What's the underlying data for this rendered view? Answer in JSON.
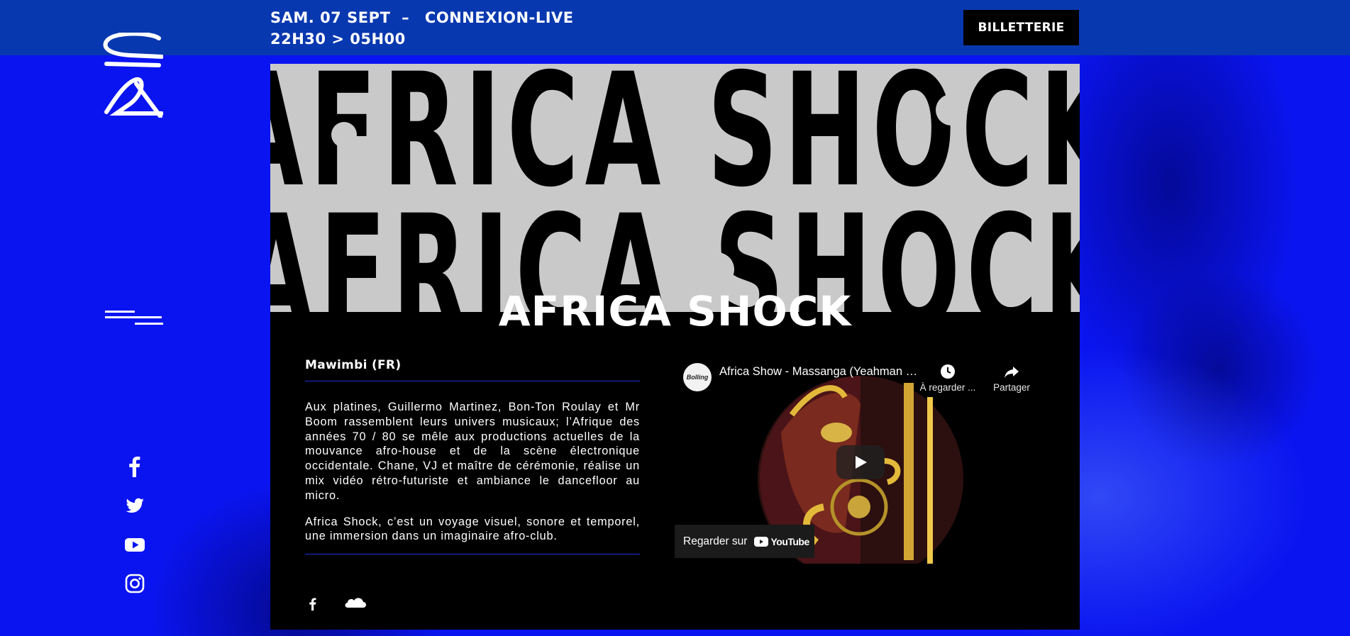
{
  "header": {
    "date": "SAM. 07 SEPT",
    "separator": "–",
    "venue": "CONNEXION-LIVE",
    "hours": "22H30 > 05H00",
    "ticket_label": "BILLETTERIE"
  },
  "sidebar": {
    "logo_icon": "cx-logo",
    "menu_icon": "hamburger-menu-icon",
    "social": [
      "facebook-icon",
      "twitter-icon",
      "youtube-icon",
      "instagram-icon"
    ]
  },
  "event": {
    "hero_art": "AFRICA SHOCK",
    "title": "AFRICA SHOCK",
    "artist": "Mawimbi (FR)",
    "paragraphs": [
      "Aux platines, Guillermo Martinez, Bon-Ton Roulay et Mr Boom rassemblent leurs univers musicaux; l’Afrique des années 70 / 80 se mêle aux productions actuelles de la mouvance afro-house et de la scène électronique occidentale. Chane, VJ et maître de cérémonie, réalise un mix vidéo rétro-futuriste et ambiance le dancefloor au micro.",
      "Africa Shock, c’est un voyage visuel, sonore et temporel, une immersion dans un imaginaire afro-club."
    ],
    "links": [
      "facebook-icon",
      "soundcloud-icon"
    ]
  },
  "video": {
    "title": "Africa Show - Massanga (Yeahman Remix)",
    "watch_later": "À regarder ...",
    "share": "Partager",
    "watch_on": "Regarder sur",
    "platform": "YouTube",
    "channel_badge": "Bolling"
  },
  "colors": {
    "background_blue": "#0a14f0",
    "topbar": "#0838b0",
    "card": "#000000",
    "hero_gray": "#c9c9c9",
    "rule_blue": "#1a2fd6"
  }
}
